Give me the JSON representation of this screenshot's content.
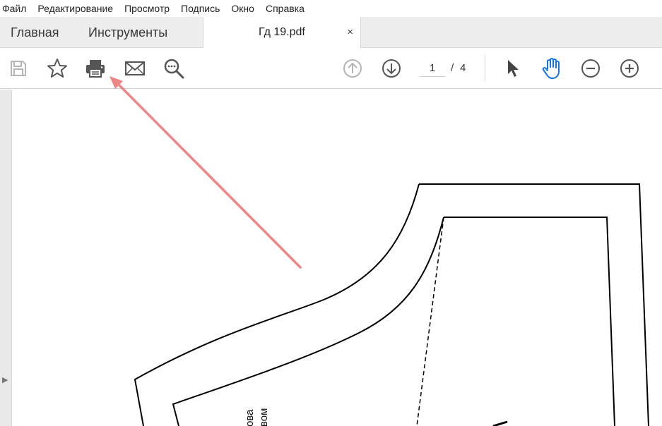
{
  "menu": [
    "Файл",
    "Редактирование",
    "Просмотр",
    "Подпись",
    "Окно",
    "Справка"
  ],
  "tabs": {
    "home": "Главная",
    "tools": "Инструменты",
    "document": "Гд 19.pdf",
    "close": "×"
  },
  "toolbar": {
    "icons": [
      "save-icon",
      "star-icon",
      "print-icon",
      "mail-icon",
      "search-more-icon",
      "page-up-icon",
      "page-down-icon",
      "select-arrow-icon",
      "hand-icon",
      "zoom-out-icon",
      "zoom-in-icon"
    ],
    "current_page": "1",
    "page_separator": "/",
    "total_pages": "4"
  },
  "document": {
    "pattern_text_1": "ова",
    "pattern_text_2": "вом"
  },
  "colors": {
    "accent_blue": "#1473e6",
    "annotation_arrow": "#f08585",
    "icon_gray": "#555555",
    "disabled_gray": "#b5b5b5"
  }
}
